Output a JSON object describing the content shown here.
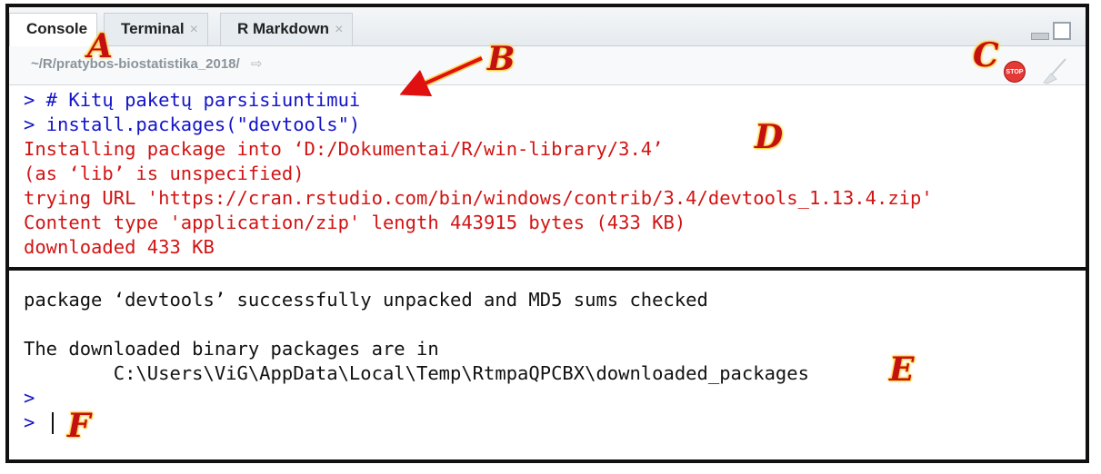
{
  "tabs": [
    {
      "label": "Console",
      "active": true
    },
    {
      "label": "Terminal",
      "close": "×"
    },
    {
      "label": "R Markdown",
      "close": "×"
    }
  ],
  "path": "~/R/pratybos-biostatistika_2018/",
  "stop_label": "STOP",
  "console": {
    "lines_top": [
      {
        "text": "> # Kitų paketų parsisiuntimui",
        "color": "blue"
      },
      {
        "text": "> install.packages(\"devtools\")",
        "color": "blue"
      },
      {
        "text": "Installing package into ‘D:/Dokumentai/R/win-library/3.4’",
        "color": "red"
      },
      {
        "text": "(as ‘lib’ is unspecified)",
        "color": "red"
      },
      {
        "text": "trying URL 'https://cran.rstudio.com/bin/windows/contrib/3.4/devtools_1.13.4.zip'",
        "color": "red"
      },
      {
        "text": "Content type 'application/zip' length 443915 bytes (433 KB)",
        "color": "red"
      },
      {
        "text": "downloaded 433 KB",
        "color": "red"
      }
    ],
    "lines_bottom": [
      {
        "text": "package ‘devtools’ successfully unpacked and MD5 sums checked",
        "color": "black"
      },
      {
        "text": "The downloaded binary packages are in",
        "color": "black"
      },
      {
        "text": "        C:\\Users\\ViG\\AppData\\Local\\Temp\\RtmpaQPCBX\\downloaded_packages",
        "color": "black"
      },
      {
        "text": ">",
        "color": "blue"
      },
      {
        "text": "> ",
        "color": "blue"
      }
    ]
  },
  "annotations": {
    "a": "A",
    "b": "B",
    "c": "C",
    "d": "D",
    "e": "E",
    "f": "F"
  },
  "colors": {
    "prompt": "#1414c8",
    "message": "#d21414",
    "annotation": "#c41010"
  }
}
